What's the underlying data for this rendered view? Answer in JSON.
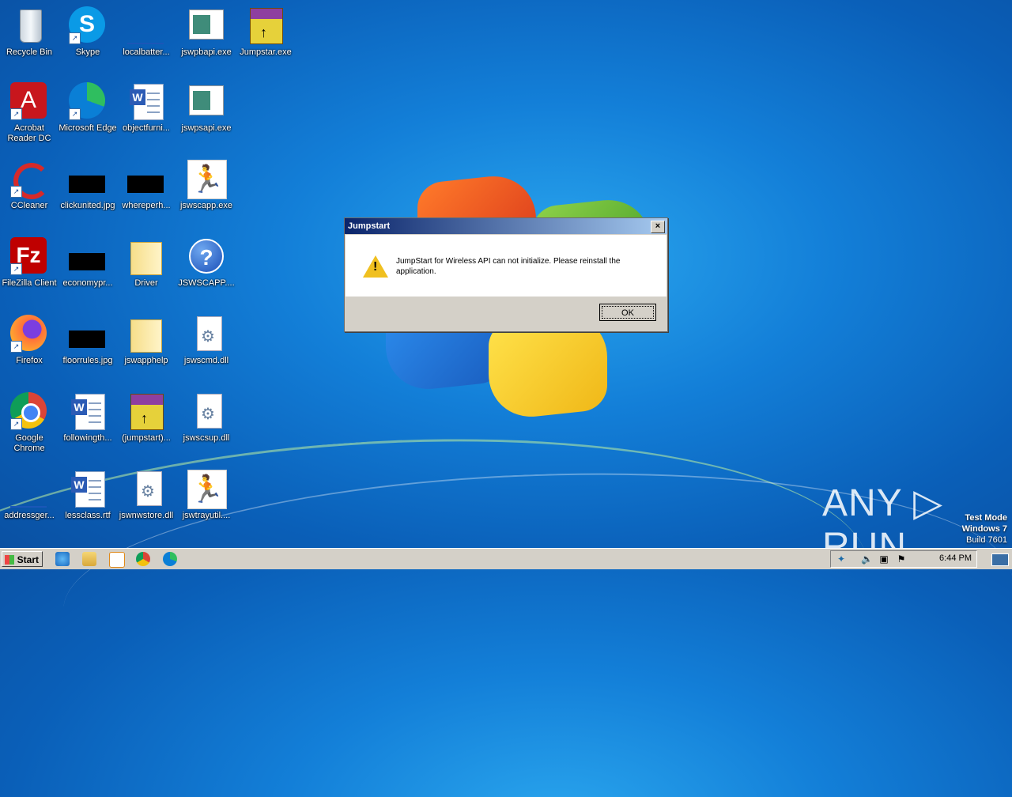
{
  "desktop": {
    "icons": [
      {
        "label": "Recycle Bin"
      },
      {
        "label": "Skype"
      },
      {
        "label": "localbatter..."
      },
      {
        "label": "jswpbapi.exe"
      },
      {
        "label": "Jumpstar.exe"
      },
      {
        "label": "Acrobat Reader DC"
      },
      {
        "label": "Microsoft Edge"
      },
      {
        "label": "objectfurni..."
      },
      {
        "label": "jswpsapi.exe"
      },
      {
        "label": "CCleaner"
      },
      {
        "label": "clickunited.jpg"
      },
      {
        "label": "whereperh..."
      },
      {
        "label": "jswscapp.exe"
      },
      {
        "label": "FileZilla Client"
      },
      {
        "label": "economypr..."
      },
      {
        "label": "Driver"
      },
      {
        "label": "JSWSCAPP...."
      },
      {
        "label": "Firefox"
      },
      {
        "label": "floorrules.jpg"
      },
      {
        "label": "jswapphelp"
      },
      {
        "label": "jswscmd.dll"
      },
      {
        "label": "Google Chrome"
      },
      {
        "label": "followingth..."
      },
      {
        "label": "(jumpstart)..."
      },
      {
        "label": "jswscsup.dll"
      },
      {
        "label": "addressger..."
      },
      {
        "label": "lessclass.rtf"
      },
      {
        "label": "jswnwstore.dll"
      },
      {
        "label": "jswtrayutil...."
      }
    ]
  },
  "dialog": {
    "title": "Jumpstart",
    "close_glyph": "×",
    "message": "JumpStart for Wireless API can not initialize.  Please reinstall the application.",
    "ok_label": "OK"
  },
  "watermark": {
    "text": "ANY ▷ RUN"
  },
  "testmode": {
    "line1": "Test Mode",
    "line2": "Windows 7",
    "line3": "Build 7601"
  },
  "taskbar": {
    "start_label": "Start",
    "clock": "6:44 PM"
  }
}
